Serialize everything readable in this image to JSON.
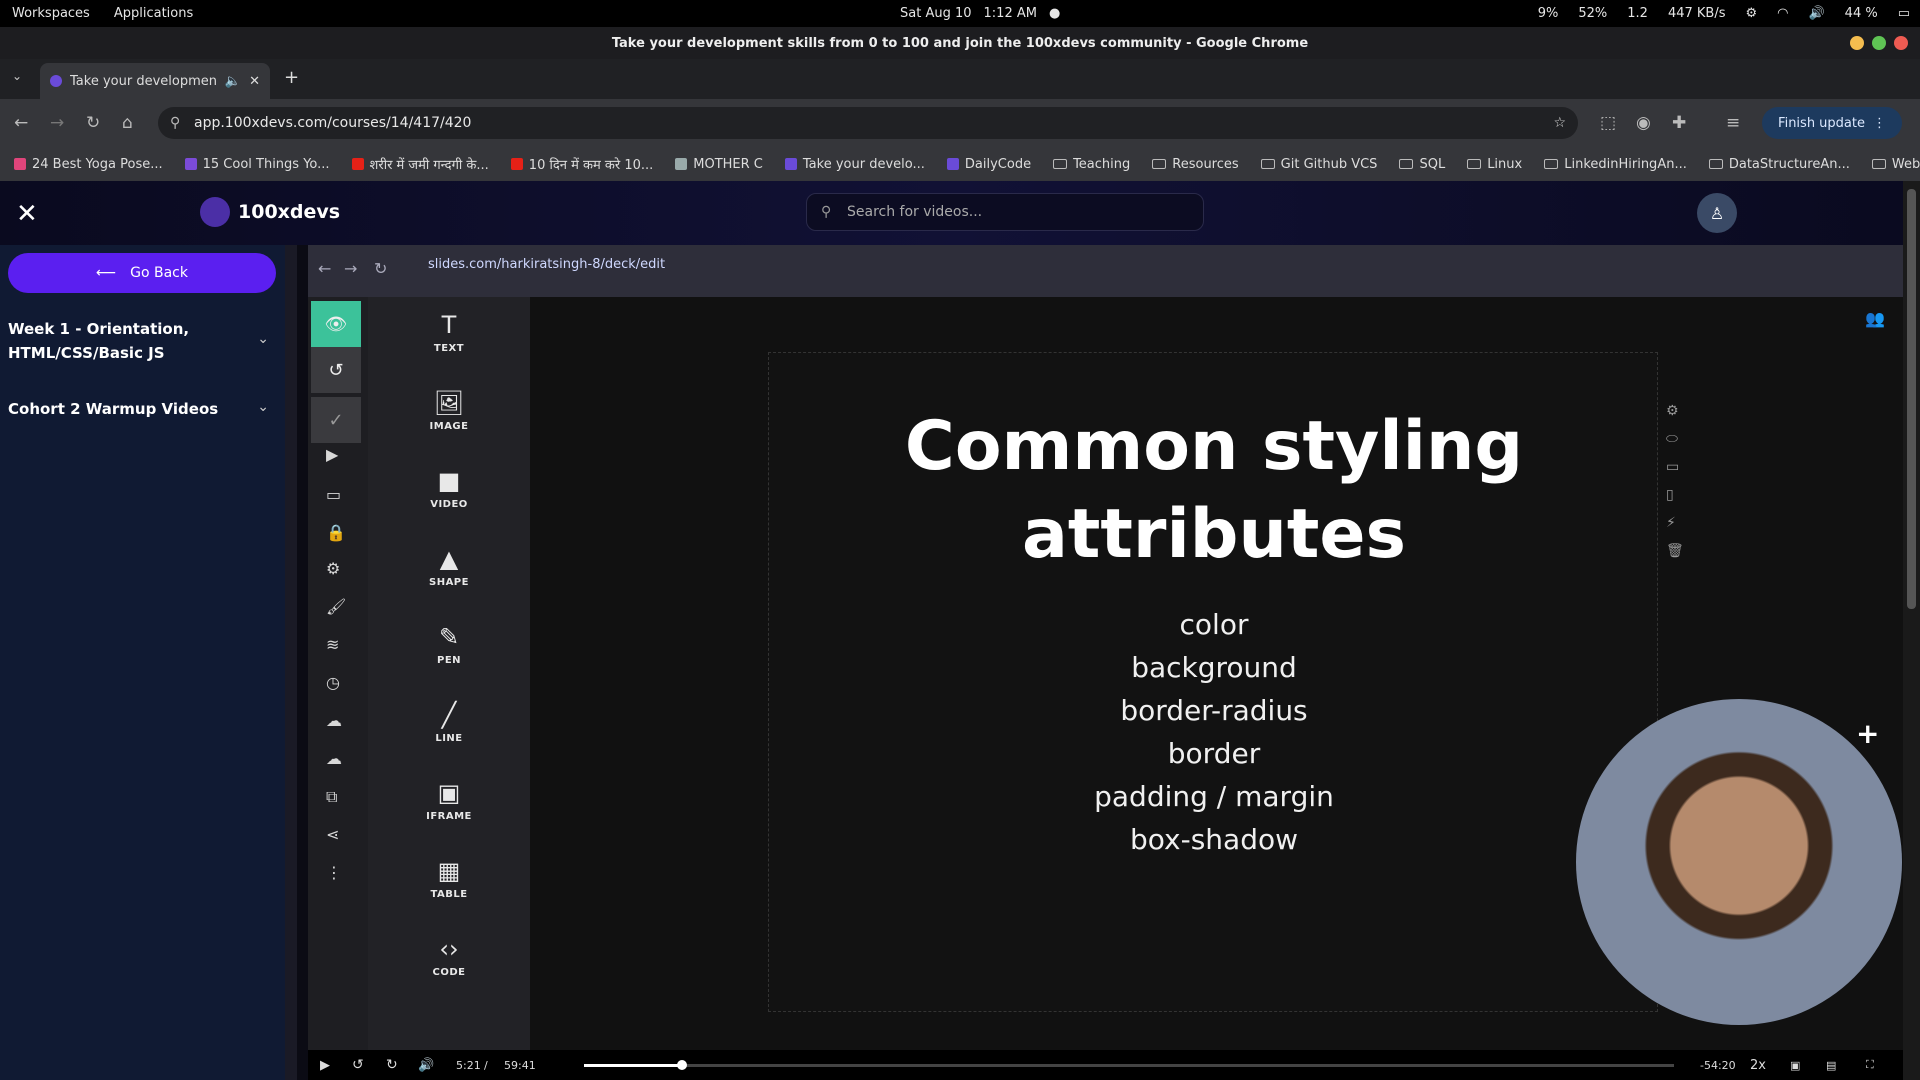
{
  "system_bar": {
    "workspaces": "Workspaces",
    "applications": "Applications",
    "date": "Sat Aug 10",
    "time": "1:12 AM",
    "cpu": "9%",
    "battery_indicator": "52%",
    "monitor_value": "1.2",
    "network": "447 KB/s",
    "battery": "44 %"
  },
  "window": {
    "title": "Take your development skills from 0 to 100 and join the 100xdevs community - Google Chrome"
  },
  "tab": {
    "label": "Take your development s"
  },
  "address_bar": {
    "url": "app.100xdevs.com/courses/14/417/420",
    "finish_update": "Finish update"
  },
  "bookmarks": [
    {
      "label": "24 Best Yoga Pose...",
      "icon": "pin-icon"
    },
    {
      "label": "15 Cool Things Yo...",
      "icon": "purple-icon"
    },
    {
      "label": "शरीर में जमी गन्दगी के...",
      "icon": "youtube-icon"
    },
    {
      "label": "10 दिन में कम करे 10...",
      "icon": "youtube-icon"
    },
    {
      "label": "MOTHER C",
      "icon": "image-icon"
    },
    {
      "label": "Take your develo...",
      "icon": "site-icon"
    },
    {
      "label": "DailyCode",
      "icon": "site-icon"
    },
    {
      "label": "Teaching",
      "icon": "folder-icon"
    },
    {
      "label": "Resources",
      "icon": "folder-icon"
    },
    {
      "label": "Git Github VCS",
      "icon": "folder-icon"
    },
    {
      "label": "SQL",
      "icon": "folder-icon"
    },
    {
      "label": "Linux",
      "icon": "folder-icon"
    },
    {
      "label": "LinkedinHiringAn...",
      "icon": "folder-icon"
    },
    {
      "label": "DataStructureAn...",
      "icon": "folder-icon"
    },
    {
      "label": "WebDev",
      "icon": "folder-icon"
    }
  ],
  "app_header": {
    "brand": "100xdevs",
    "search_placeholder": "Search for videos..."
  },
  "sidebar": {
    "go_back": "Go Back",
    "sections": [
      {
        "label": "Week 1 - Orientation, HTML/CSS/Basic JS"
      },
      {
        "label": "Cohort 2 Warmup Videos"
      }
    ]
  },
  "video": {
    "inner_url": "slides.com/harkiratsingh-8/deck/edit",
    "elements": [
      {
        "label": "TEXT",
        "glyph": "T"
      },
      {
        "label": "IMAGE",
        "glyph": "🖼"
      },
      {
        "label": "VIDEO",
        "glyph": "■"
      },
      {
        "label": "SHAPE",
        "glyph": "▲"
      },
      {
        "label": "PEN",
        "glyph": "✎"
      },
      {
        "label": "LINE",
        "glyph": "╱"
      },
      {
        "label": "IFRAME",
        "glyph": "▣"
      },
      {
        "label": "TABLE",
        "glyph": "▦"
      },
      {
        "label": "CODE",
        "glyph": "‹›"
      }
    ],
    "slide": {
      "title_line1": "Common styling",
      "title_line2": "attributes",
      "items": [
        "color",
        "background",
        "border-radius",
        "border",
        "padding / margin",
        "box-shadow"
      ]
    },
    "player": {
      "current_time": "5:21",
      "separator": "/",
      "duration": "59:41",
      "remaining": "-54:20",
      "speed": "2x",
      "progress": 0.09
    }
  }
}
